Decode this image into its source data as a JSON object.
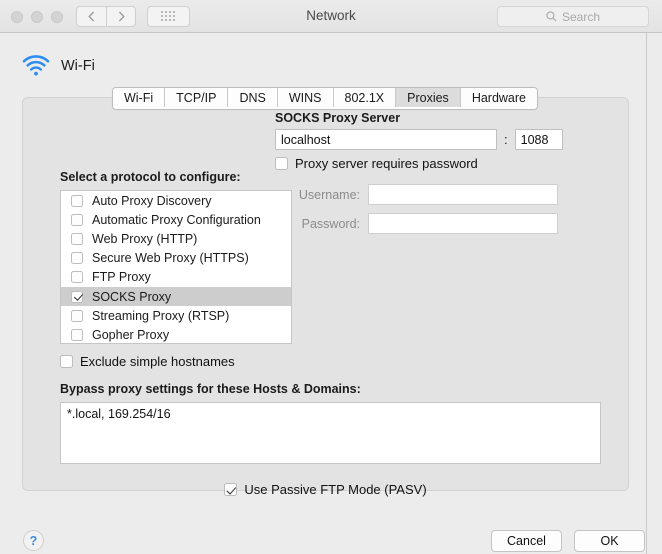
{
  "window": {
    "title": "Network",
    "traffic_lights": [
      "close",
      "minimize",
      "zoom"
    ],
    "nav": {
      "back": "‹",
      "forward": "›"
    },
    "grid_button": "show-all",
    "search": {
      "placeholder": "Search",
      "value": ""
    }
  },
  "service": {
    "name": "Wi-Fi",
    "icon": "wifi-icon"
  },
  "tabs": [
    {
      "label": "Wi-Fi",
      "selected": false
    },
    {
      "label": "TCP/IP",
      "selected": false
    },
    {
      "label": "DNS",
      "selected": false
    },
    {
      "label": "WINS",
      "selected": false
    },
    {
      "label": "802.1X",
      "selected": false
    },
    {
      "label": "Proxies",
      "selected": true
    },
    {
      "label": "Hardware",
      "selected": false
    }
  ],
  "protocols": {
    "label": "Select a protocol to configure:",
    "items": [
      {
        "label": "Auto Proxy Discovery",
        "checked": false,
        "selected": false
      },
      {
        "label": "Automatic Proxy Configuration",
        "checked": false,
        "selected": false
      },
      {
        "label": "Web Proxy (HTTP)",
        "checked": false,
        "selected": false
      },
      {
        "label": "Secure Web Proxy (HTTPS)",
        "checked": false,
        "selected": false
      },
      {
        "label": "FTP Proxy",
        "checked": false,
        "selected": false
      },
      {
        "label": "SOCKS Proxy",
        "checked": true,
        "selected": true
      },
      {
        "label": "Streaming Proxy (RTSP)",
        "checked": false,
        "selected": false
      },
      {
        "label": "Gopher Proxy",
        "checked": false,
        "selected": false
      }
    ]
  },
  "exclude_simple_hostnames": {
    "label": "Exclude simple hostnames",
    "checked": false
  },
  "bypass": {
    "label": "Bypass proxy settings for these Hosts & Domains:",
    "value": "*.local, 169.254/16"
  },
  "proxy_config": {
    "title": "SOCKS Proxy Server",
    "host": "localhost",
    "separator": ":",
    "port": "1088",
    "requires_password": {
      "label": "Proxy server requires password",
      "checked": false
    },
    "username": {
      "label": "Username:",
      "value": "",
      "enabled": false
    },
    "password": {
      "label": "Password:",
      "value": "",
      "enabled": false
    }
  },
  "passive_ftp": {
    "label": "Use Passive FTP Mode (PASV)",
    "checked": true
  },
  "footer": {
    "help": "?",
    "cancel": "Cancel",
    "ok": "OK"
  },
  "colors": {
    "accent": "#3e8ee0",
    "wifi_icon": "#2d8cf0",
    "window_bg": "#ececec",
    "panel_bg": "#e3e3e3",
    "selected_row": "#cdcdcd"
  }
}
